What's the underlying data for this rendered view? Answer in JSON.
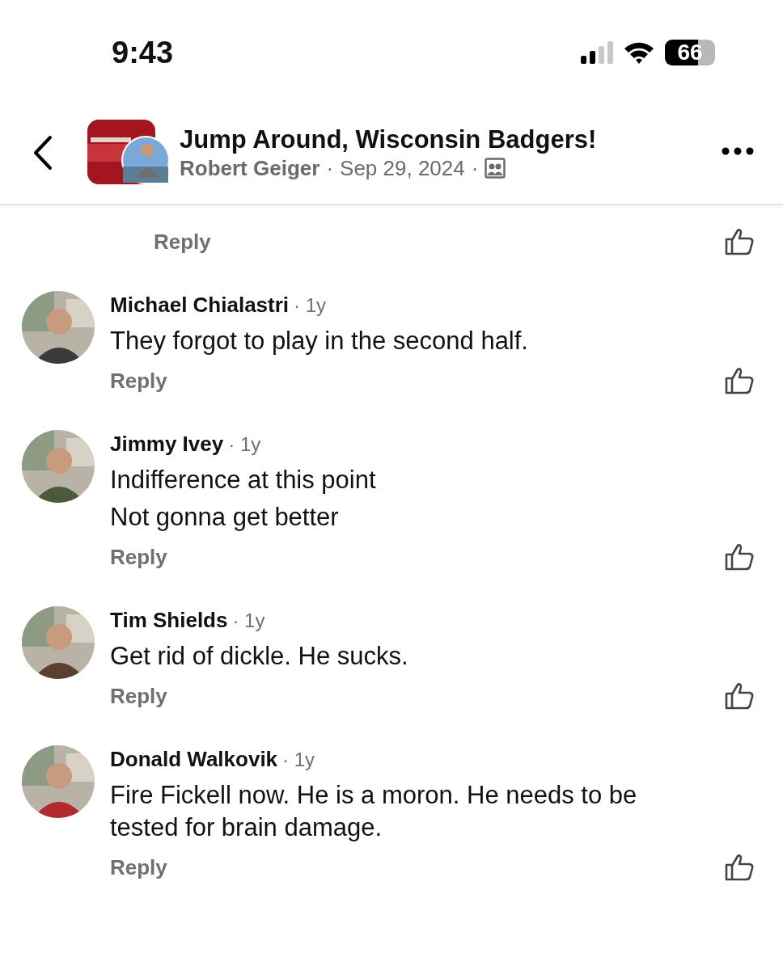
{
  "status_bar": {
    "time": "9:43",
    "battery": "66"
  },
  "header": {
    "title": "Jump Around, Wisconsin Badgers!",
    "author": "Robert Geiger",
    "date": "Sep 29, 2024",
    "separator": "·"
  },
  "top_reply": {
    "label": "Reply"
  },
  "comments": [
    {
      "name": "Michael Chialastri",
      "age": "· 1y",
      "lines": [
        "They forgot to play in the second half."
      ],
      "reply": "Reply",
      "avatar": {
        "kind": "picture"
      }
    },
    {
      "name": "Jimmy Ivey",
      "age": "· 1y",
      "lines": [
        "Indifference at this point",
        "Not gonna get better"
      ],
      "reply": "Reply",
      "avatar": {
        "kind": "picture"
      }
    },
    {
      "name": "Tim Shields",
      "age": "· 1y",
      "lines": [
        "Get rid of dickle. He sucks."
      ],
      "reply": "Reply",
      "avatar": {
        "kind": "picture"
      }
    },
    {
      "name": "Donald Walkovik",
      "age": "· 1y",
      "lines": [
        "Fire Fickell now. He is a moron. He needs to be tested for brain damage."
      ],
      "reply": "Reply",
      "avatar": {
        "kind": "picture"
      }
    }
  ]
}
